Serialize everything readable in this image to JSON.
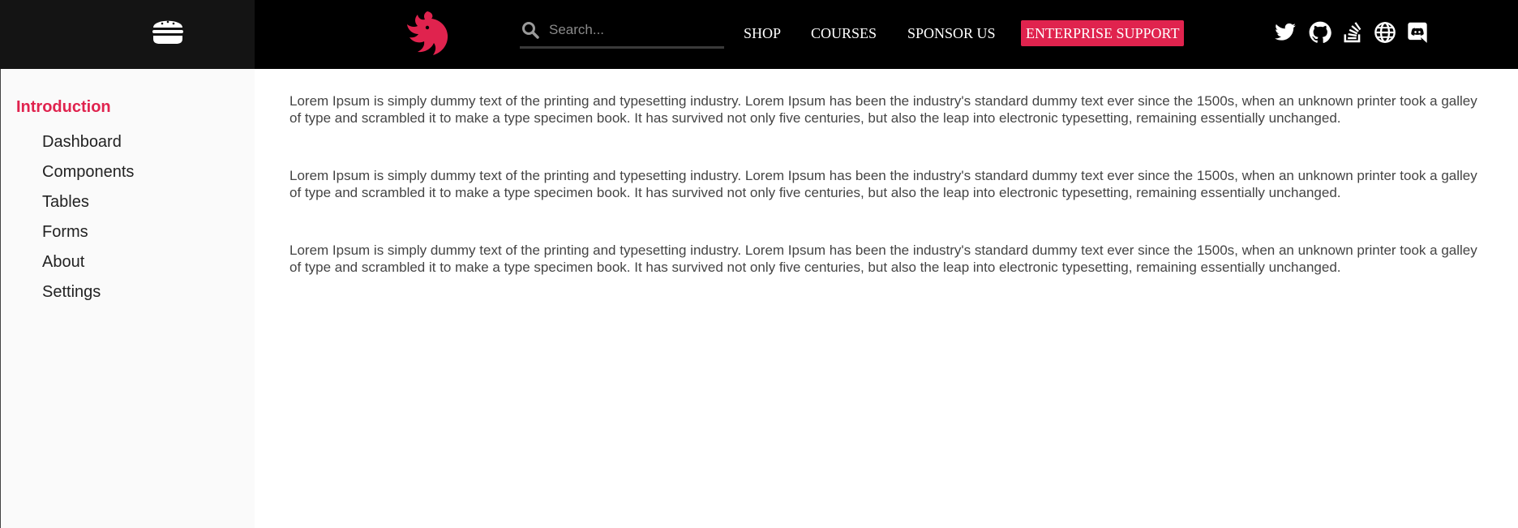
{
  "header": {
    "menu_icon": "hamburger-burger-icon",
    "logo_icon": "nest-cat-logo",
    "search": {
      "placeholder": "Search...",
      "value": ""
    },
    "nav": {
      "shop": "SHOP",
      "courses": "COURSES",
      "sponsor": "SPONSOR US",
      "enterprise": "ENTERPRISE SUPPORT"
    },
    "social_icons": [
      "twitter-icon",
      "github-icon",
      "stackoverflow-icon",
      "globe-icon",
      "discord-icon"
    ]
  },
  "sidebar": {
    "heading": "Introduction",
    "items": [
      {
        "label": "Dashboard"
      },
      {
        "label": "Components"
      },
      {
        "label": "Tables"
      },
      {
        "label": "Forms"
      },
      {
        "label": "About"
      },
      {
        "label": "Settings"
      }
    ]
  },
  "main": {
    "paragraphs": [
      "Lorem Ipsum is simply dummy text of the printing and typesetting industry. Lorem Ipsum has been the industry's standard dummy text ever since the 1500s, when an unknown printer took a galley of type and scrambled it to make a type specimen book. It has survived not only five centuries, but also the leap into electronic typesetting, remaining essentially unchanged.",
      "Lorem Ipsum is simply dummy text of the printing and typesetting industry. Lorem Ipsum has been the industry's standard dummy text ever since the 1500s, when an unknown printer took a galley of type and scrambled it to make a type specimen book. It has survived not only five centuries, but also the leap into electronic typesetting, remaining essentially unchanged.",
      "Lorem Ipsum is simply dummy text of the printing and typesetting industry. Lorem Ipsum has been the industry's standard dummy text ever since the 1500s, when an unknown printer took a galley of type and scrambled it to make a type specimen book. It has survived not only five centuries, but also the leap into electronic typesetting, remaining essentially unchanged."
    ]
  },
  "colors": {
    "accent": "#e0234e",
    "header_bg": "#000000",
    "menu_zone_bg": "#141414",
    "sidebar_bg": "#fafafa",
    "text": "#444444"
  }
}
